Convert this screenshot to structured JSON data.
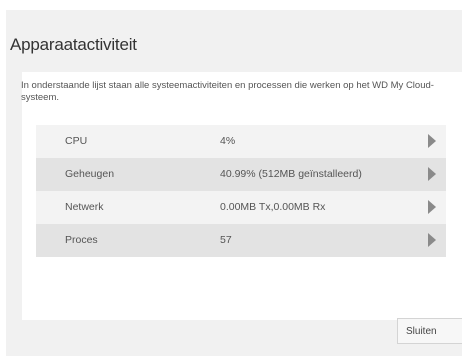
{
  "dialog": {
    "title": "Apparaatactiviteit",
    "description": "In onderstaande lijst staan alle systeemactiviteiten en processen die werken op het WD My Cloud-systeem.",
    "close_label": "Sluiten"
  },
  "activity": {
    "rows": [
      {
        "label": "CPU",
        "value": "4%"
      },
      {
        "label": "Geheugen",
        "value": "40.99% (512MB geïnstalleerd)"
      },
      {
        "label": "Netwerk",
        "value": "0.00MB Tx,0.00MB Rx"
      },
      {
        "label": "Proces",
        "value": "57"
      }
    ]
  },
  "icons": {
    "row_arrow": "chevron-right-icon"
  },
  "colors": {
    "row_light": "#f3f3f3",
    "row_dark": "#e3e3e3",
    "dialog_bg": "#f1f1f1",
    "arrow": "#8a8a8a"
  }
}
